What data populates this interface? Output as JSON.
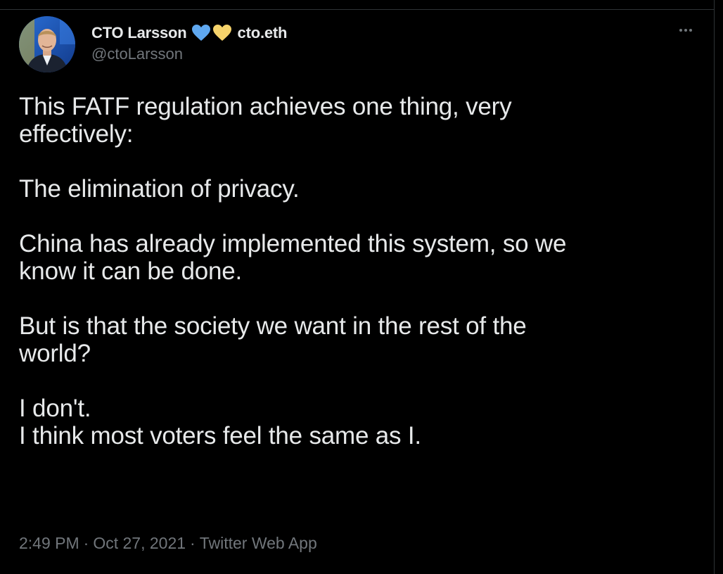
{
  "author": {
    "display_name": "CTO Larsson",
    "ens_name": "cto.eth",
    "handle": "@ctoLarsson",
    "avatar_icon": "profile-photo",
    "heart_icons": [
      "blue-heart-icon",
      "yellow-heart-icon"
    ]
  },
  "tweet": {
    "paragraphs": [
      [
        "This FATF regulation achieves one thing, very",
        "effectively:"
      ],
      [
        "The elimination of privacy."
      ],
      [
        "China has already implemented this system, so we",
        "know it can be done."
      ],
      [
        "But is that the society we want in the rest of the",
        "world?"
      ],
      [
        "I don't.",
        "I think most voters feel the same as I."
      ]
    ]
  },
  "meta": {
    "time": "2:49 PM",
    "date": "Oct 27, 2021",
    "source": "Twitter Web App",
    "separator": "·"
  },
  "colors": {
    "background": "#000000",
    "text": "#e7e9ea",
    "secondary": "#71767b",
    "heart_blue": "#5fa8f0",
    "heart_yellow": "#f6d36b"
  }
}
